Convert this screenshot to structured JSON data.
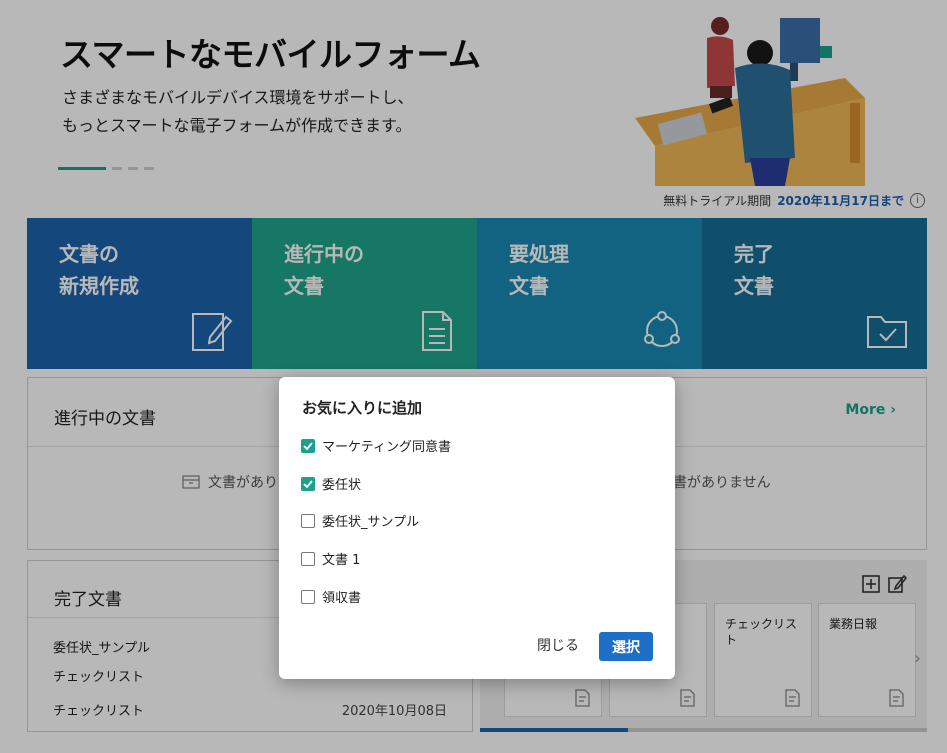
{
  "hero": {
    "title": "スマートなモバイルフォーム",
    "subtitle_line1": "さまざまなモバイルデバイス環境をサポートし、",
    "subtitle_line2": "もっとスマートな電子フォームが作成できます。"
  },
  "trial": {
    "label": "無料トライアル期間",
    "date": "2020年11月17日まで",
    "icon": "info-icon"
  },
  "tiles": [
    {
      "line1": "文書の",
      "line2": "新規作成",
      "icon": "edit-document-icon"
    },
    {
      "line1": "進行中の",
      "line2": "文書",
      "icon": "document-lines-icon"
    },
    {
      "line1": "要処理",
      "line2": "文書",
      "icon": "cycle-icon"
    },
    {
      "line1": "完了",
      "line2": "文書",
      "icon": "folder-check-icon"
    }
  ],
  "in_progress": {
    "title": "進行中の文書",
    "more": "More",
    "empty_left": "文書があり",
    "empty_right": "書がありません"
  },
  "completed": {
    "title": "完了文書",
    "rows": [
      {
        "name": "委任状_サンプル",
        "date": ""
      },
      {
        "name": "チェックリスト",
        "date": ""
      },
      {
        "name": "チェックリスト",
        "date": "2020年10月08日"
      }
    ]
  },
  "templates": {
    "cards": [
      {
        "name": "チェックリスト"
      },
      {
        "name": "業務日報"
      }
    ]
  },
  "dialog": {
    "title": "お気に入りに追加",
    "options": [
      {
        "label": "マーケティング同意書",
        "checked": true
      },
      {
        "label": "委任状",
        "checked": true
      },
      {
        "label": "委任状_サンプル",
        "checked": false
      },
      {
        "label": "文書 1",
        "checked": false
      },
      {
        "label": "領収書",
        "checked": false
      }
    ],
    "close_label": "閉じる",
    "select_label": "選択"
  },
  "colors": {
    "accent_green": "#1aa38a",
    "primary_blue": "#1d6fc7"
  }
}
